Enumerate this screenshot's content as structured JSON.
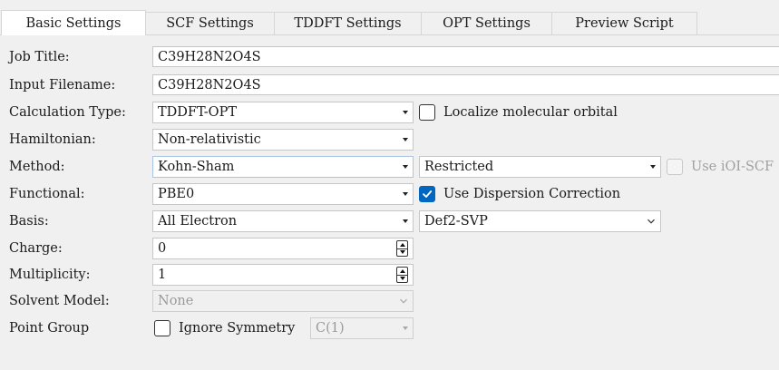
{
  "tabs": [
    {
      "label": "Basic Settings",
      "active": true
    },
    {
      "label": "SCF Settings",
      "active": false
    },
    {
      "label": "TDDFT Settings",
      "active": false
    },
    {
      "label": "OPT Settings",
      "active": false
    },
    {
      "label": "Preview Script",
      "active": false
    }
  ],
  "form": {
    "job_title": {
      "label": "Job Title:",
      "value": "C39H28N2O4S"
    },
    "input_filename": {
      "label": "Input Filename:",
      "value": "C39H28N2O4S"
    },
    "calculation_type": {
      "label": "Calculation Type:",
      "value": "TDDFT-OPT"
    },
    "localize_orbital": {
      "label": "Localize molecular orbital",
      "checked": false
    },
    "hamiltonian": {
      "label": "Hamiltonian:",
      "value": "Non-relativistic"
    },
    "method": {
      "label": "Method:",
      "value": "Kohn-Sham",
      "scf_type": "Restricted"
    },
    "use_ioi_scf": {
      "label": "Use iOI-SCF",
      "checked": false,
      "enabled": false
    },
    "functional": {
      "label": "Functional:",
      "value": "PBE0"
    },
    "dispersion": {
      "label": "Use Dispersion Correction",
      "checked": true
    },
    "basis": {
      "label": "Basis:",
      "value": "All Electron",
      "set": "Def2-SVP"
    },
    "charge": {
      "label": "Charge:",
      "value": "0"
    },
    "multiplicity": {
      "label": "Multiplicity:",
      "value": "1"
    },
    "solvent_model": {
      "label": "Solvent Model:",
      "value": "None"
    },
    "point_group": {
      "label": "Point Group",
      "value": "C(1)"
    },
    "ignore_symmetry": {
      "label": "Ignore Symmetry",
      "checked": false
    }
  },
  "colors": {
    "accent": "#0067c0",
    "panel_bg": "#f0f0f0",
    "field_border": "#c6c6c6"
  }
}
